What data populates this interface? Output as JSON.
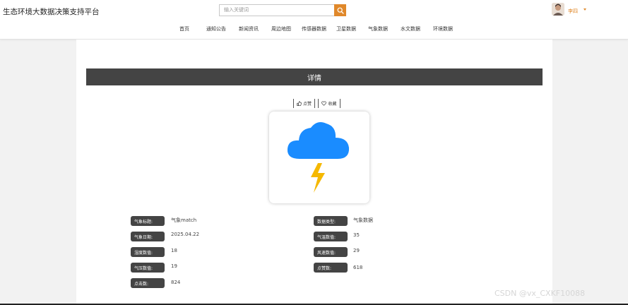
{
  "header": {
    "site_title": "生态环境大数据决策支持平台",
    "search_placeholder": "输入关键词",
    "search_icon": "search-icon",
    "user_name": "李四"
  },
  "nav": {
    "items": [
      {
        "label": "首页"
      },
      {
        "label": "通知公告"
      },
      {
        "label": "新闻资讯"
      },
      {
        "label": "周边地图"
      },
      {
        "label": "传感器数据"
      },
      {
        "label": "卫星数据"
      },
      {
        "label": "气象数据"
      },
      {
        "label": "水文数据"
      },
      {
        "label": "环境数据"
      }
    ]
  },
  "detail": {
    "title": "详情",
    "like_label": "点赞",
    "favorite_label": "收藏",
    "image_icon": "thunderstorm-icon"
  },
  "fields": [
    {
      "label": "气象标题:",
      "value": "气象match"
    },
    {
      "label": "数据类型:",
      "value": "气象数据"
    },
    {
      "label": "气象日期:",
      "value": "2025.04.22"
    },
    {
      "label": "气温数值:",
      "value": "35"
    },
    {
      "label": "湿度数值:",
      "value": "18"
    },
    {
      "label": "风速数值:",
      "value": "29"
    },
    {
      "label": "气压数值:",
      "value": "19"
    },
    {
      "label": "点赞数:",
      "value": "618"
    },
    {
      "label": "点击数:",
      "value": "824"
    }
  ],
  "watermark": "CSDN @vx_CXKF10088",
  "colors": {
    "accent": "#e0882a",
    "dark_bar": "#444444",
    "cloud": "#1a8cff",
    "lightning": "#f5b800"
  }
}
